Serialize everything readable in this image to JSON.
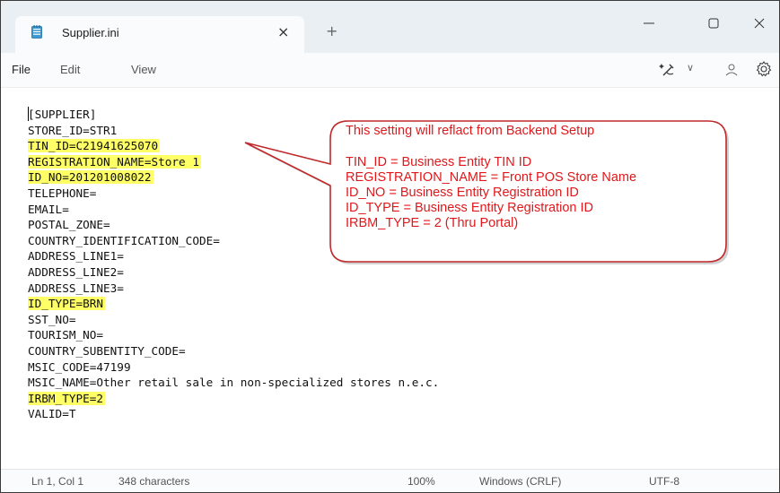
{
  "window": {
    "tab_title": "Supplier.ini",
    "tab_close": "×",
    "new_tab": "+"
  },
  "menu": {
    "file": "File",
    "edit": "Edit",
    "view": "View",
    "chevron": "∨"
  },
  "editor": {
    "lines": [
      "[SUPPLIER]",
      "STORE_ID=STR1",
      "TIN_ID=C21941625070",
      "REGISTRATION_NAME=Store 1",
      "ID_NO=201201008022",
      "TELEPHONE=",
      "EMAIL=",
      "POSTAL_ZONE=",
      "COUNTRY_IDENTIFICATION_CODE=",
      "ADDRESS_LINE1=",
      "ADDRESS_LINE2=",
      "ADDRESS_LINE3=",
      "ID_TYPE=BRN",
      "SST_NO=",
      "TOURISM_NO=",
      "COUNTRY_SUBENTITY_CODE=",
      "MSIC_CODE=47199",
      "MSIC_NAME=Other retail sale in non-specialized stores n.e.c.",
      "IRBM_TYPE=2",
      "VALID=T"
    ],
    "highlight_color": "#ffff66"
  },
  "callout": {
    "heading": "This setting will reflact from Backend Setup",
    "lines": [
      "TIN_ID = Business Entity TIN ID",
      "REGISTRATION_NAME = Front POS Store Name",
      "ID_NO = Business Entity Registration ID",
      "ID_TYPE = Business Entity Registration ID",
      "IRBM_TYPE = 2 (Thru Portal)"
    ],
    "text_color": "#e0181b",
    "border_color": "#c0282b"
  },
  "status": {
    "position": "Ln 1, Col 1",
    "characters": "348 characters",
    "zoom": "100%",
    "line_ending": "Windows (CRLF)",
    "encoding": "UTF-8"
  }
}
